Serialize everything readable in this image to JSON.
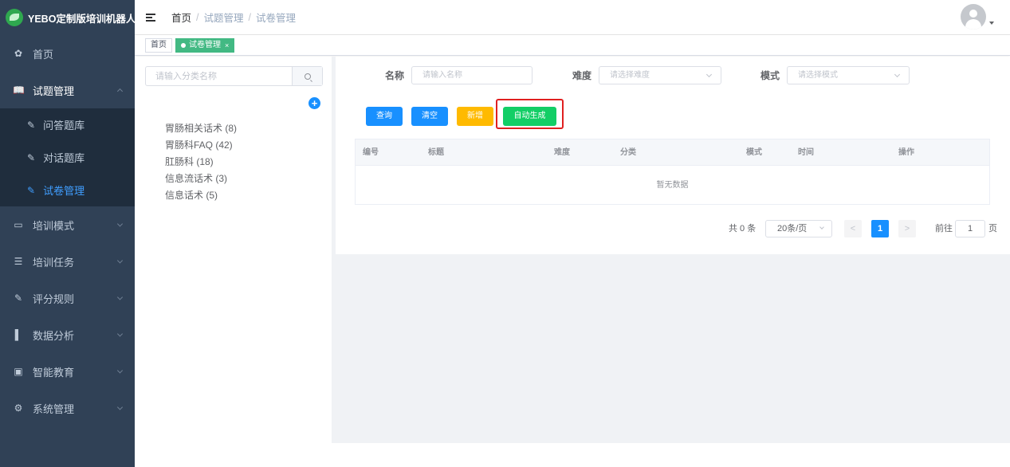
{
  "app": {
    "title": "YEBO定制版培训机器人"
  },
  "sidebar": {
    "items": [
      {
        "label": "首页",
        "icon": "dashboard-icon"
      },
      {
        "label": "试题管理",
        "icon": "book-icon",
        "expanded": true,
        "children": [
          {
            "label": "问答题库",
            "icon": "edit-icon"
          },
          {
            "label": "对话题库",
            "icon": "edit-icon"
          },
          {
            "label": "试卷管理",
            "icon": "edit-icon",
            "active": true
          }
        ]
      },
      {
        "label": "培训模式",
        "icon": "monitor-icon"
      },
      {
        "label": "培训任务",
        "icon": "list-icon"
      },
      {
        "label": "评分规则",
        "icon": "edit-icon"
      },
      {
        "label": "数据分析",
        "icon": "chart-icon"
      },
      {
        "label": "智能教育",
        "icon": "education-icon"
      },
      {
        "label": "系统管理",
        "icon": "gear-icon"
      }
    ]
  },
  "breadcrumb": {
    "home": "首页",
    "sep": "/",
    "level1": "试题管理",
    "level2": "试卷管理"
  },
  "tags": {
    "home": "首页",
    "current": "试卷管理",
    "close": "×"
  },
  "category": {
    "search_placeholder": "请输入分类名称",
    "add_symbol": "+",
    "nodes": [
      "胃肠相关话术 (8)",
      "胃肠科FAQ (42)",
      "肛肠科 (18)",
      "信息流话术 (3)",
      "信息话术 (5)"
    ]
  },
  "filters": {
    "name_label": "名称",
    "name_placeholder": "请输入名称",
    "difficulty_label": "难度",
    "difficulty_placeholder": "请选择难度",
    "mode_label": "模式",
    "mode_placeholder": "请选择模式"
  },
  "buttons": {
    "query": "查询",
    "clear": "清空",
    "add": "新增",
    "auto_generate": "自动生成"
  },
  "table": {
    "columns": [
      "编号",
      "标题",
      "难度",
      "分类",
      "模式",
      "时间",
      "操作"
    ],
    "empty_text": "暂无数据"
  },
  "pagination": {
    "total": "共 0 条",
    "page_size": "20条/页",
    "prev": "<",
    "current_page": "1",
    "next": ">",
    "jump_label": "前往",
    "jump_value": "1",
    "page_suffix": "页"
  },
  "colors": {
    "sidebar_bg": "#304156",
    "active": "#409eff",
    "tag_active": "#42b983",
    "primary": "#1890ff",
    "warning": "#ffba00",
    "success": "#13ce66",
    "highlight": "#e02020"
  }
}
